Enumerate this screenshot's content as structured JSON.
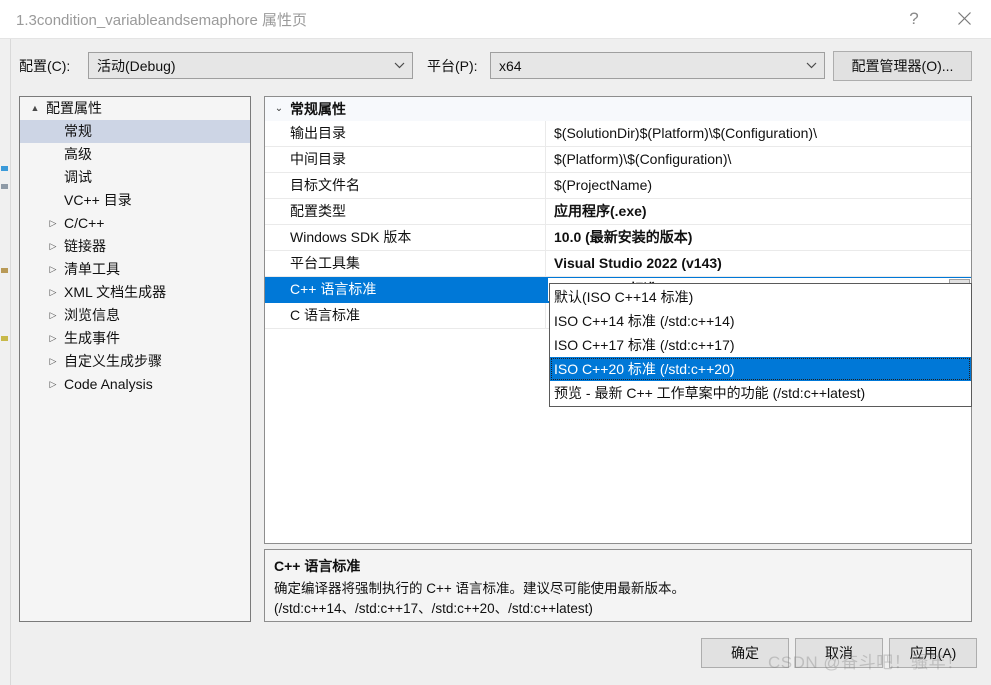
{
  "window": {
    "title": "1.3condition_variableandsemaphore 属性页",
    "help_icon": "question-mark-icon",
    "close_icon": "close-icon"
  },
  "config_bar": {
    "configuration_label": "配置(C):",
    "configuration_value": "活动(Debug)",
    "platform_label": "平台(P):",
    "platform_value": "x64",
    "config_manager_button": "配置管理器(O)...",
    "dropdown_icon": "chevron-down-icon"
  },
  "tree": {
    "items": [
      {
        "label": "配置属性",
        "depth": 0,
        "twisty": "▲",
        "expanded": true,
        "selected": false
      },
      {
        "label": "常规",
        "depth": 1,
        "twisty": "",
        "expanded": false,
        "selected": true
      },
      {
        "label": "高级",
        "depth": 1,
        "twisty": "",
        "expanded": false,
        "selected": false
      },
      {
        "label": "调试",
        "depth": 1,
        "twisty": "",
        "expanded": false,
        "selected": false
      },
      {
        "label": "VC++ 目录",
        "depth": 1,
        "twisty": "",
        "expanded": false,
        "selected": false
      },
      {
        "label": "C/C++",
        "depth": 1,
        "twisty": "▷",
        "expanded": false,
        "selected": false
      },
      {
        "label": "链接器",
        "depth": 1,
        "twisty": "▷",
        "expanded": false,
        "selected": false
      },
      {
        "label": "清单工具",
        "depth": 1,
        "twisty": "▷",
        "expanded": false,
        "selected": false
      },
      {
        "label": "XML 文档生成器",
        "depth": 1,
        "twisty": "▷",
        "expanded": false,
        "selected": false
      },
      {
        "label": "浏览信息",
        "depth": 1,
        "twisty": "▷",
        "expanded": false,
        "selected": false
      },
      {
        "label": "生成事件",
        "depth": 1,
        "twisty": "▷",
        "expanded": false,
        "selected": false
      },
      {
        "label": "自定义生成步骤",
        "depth": 1,
        "twisty": "▷",
        "expanded": false,
        "selected": false
      },
      {
        "label": "Code Analysis",
        "depth": 1,
        "twisty": "▷",
        "expanded": false,
        "selected": false
      }
    ]
  },
  "grid": {
    "category": "常规属性",
    "category_twisty": "⌄",
    "rows": [
      {
        "name": "输出目录",
        "value": "$(SolutionDir)$(Platform)\\$(Configuration)\\",
        "bold": false,
        "selected": false
      },
      {
        "name": "中间目录",
        "value": "$(Platform)\\$(Configuration)\\",
        "bold": false,
        "selected": false
      },
      {
        "name": "目标文件名",
        "value": "$(ProjectName)",
        "bold": false,
        "selected": false
      },
      {
        "name": "配置类型",
        "value": "应用程序(.exe)",
        "bold": true,
        "selected": false
      },
      {
        "name": "Windows SDK 版本",
        "value": "10.0 (最新安装的版本)",
        "bold": true,
        "selected": false
      },
      {
        "name": "平台工具集",
        "value": "Visual Studio 2022 (v143)",
        "bold": true,
        "selected": false
      },
      {
        "name": "C++ 语言标准",
        "value": "ISO C++20 标准 (/std:c++20)",
        "bold": true,
        "selected": true
      },
      {
        "name": "C 语言标准",
        "value": "",
        "bold": false,
        "selected": false
      }
    ],
    "editor_arrow_icon": "chevron-down-icon"
  },
  "dropdown": {
    "options": [
      {
        "label": "默认(ISO C++14 标准)",
        "selected": false
      },
      {
        "label": "ISO C++14 标准 (/std:c++14)",
        "selected": false
      },
      {
        "label": "ISO C++17 标准 (/std:c++17)",
        "selected": false
      },
      {
        "label": "ISO C++20 标准 (/std:c++20)",
        "selected": true
      },
      {
        "label": "预览 - 最新 C++ 工作草案中的功能 (/std:c++latest)",
        "selected": false
      }
    ]
  },
  "description": {
    "title": "C++ 语言标准",
    "body": "确定编译器将强制执行的 C++ 语言标准。建议尽可能使用最新版本。(/std:c++14、/std:c++17、/std:c++20、/std:c++latest)"
  },
  "footer": {
    "ok_label": "确定",
    "cancel_label": "取消",
    "apply_label": "应用(A)"
  },
  "watermark": {
    "text": "CSDN @奋斗吧！骚年！"
  },
  "colors": {
    "accent": "#0078d7",
    "tree_selection": "#cdd5e5",
    "dialog_bg": "#efefef"
  }
}
